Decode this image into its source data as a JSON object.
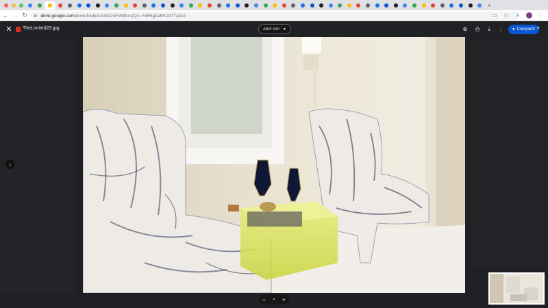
{
  "browser": {
    "tab_count": 49,
    "url_host": "drive.google.com",
    "url_path": "/drive/folders/1GE2nFoM8Vv(Qv--FxR6g0aRKJdTTp1kz",
    "traffic_colors": [
      "#ed6a5e",
      "#f5bf4f",
      "#62c554"
    ],
    "tab_favicon_colors": [
      "#4285f4",
      "#34a853",
      "#fbbc04",
      "#ea4335",
      "#5f6368",
      "#1a73e8",
      "#0b57d0",
      "#202124"
    ],
    "icons": {
      "back": "arrow-left-icon",
      "forward": "arrow-right-icon",
      "reload": "reload-icon",
      "site_info": "tune-icon",
      "cast": "cast-icon",
      "bookmark": "star-icon",
      "download": "download-icon",
      "menu": "more-vert-icon"
    }
  },
  "viewer": {
    "file_name": "TheLimited23.jpg",
    "open_with_label": "Abrir con",
    "share_label": "Compartir",
    "accent": "#0b57d0",
    "icons": {
      "close": "close-icon",
      "add_shortcut": "drive-add-icon",
      "print": "print-icon",
      "download": "download-icon",
      "more": "more-vert-icon",
      "prev": "chevron-left-icon",
      "zoom_out": "minus-icon",
      "zoom": "magnify-icon",
      "zoom_in": "plus-icon"
    }
  }
}
